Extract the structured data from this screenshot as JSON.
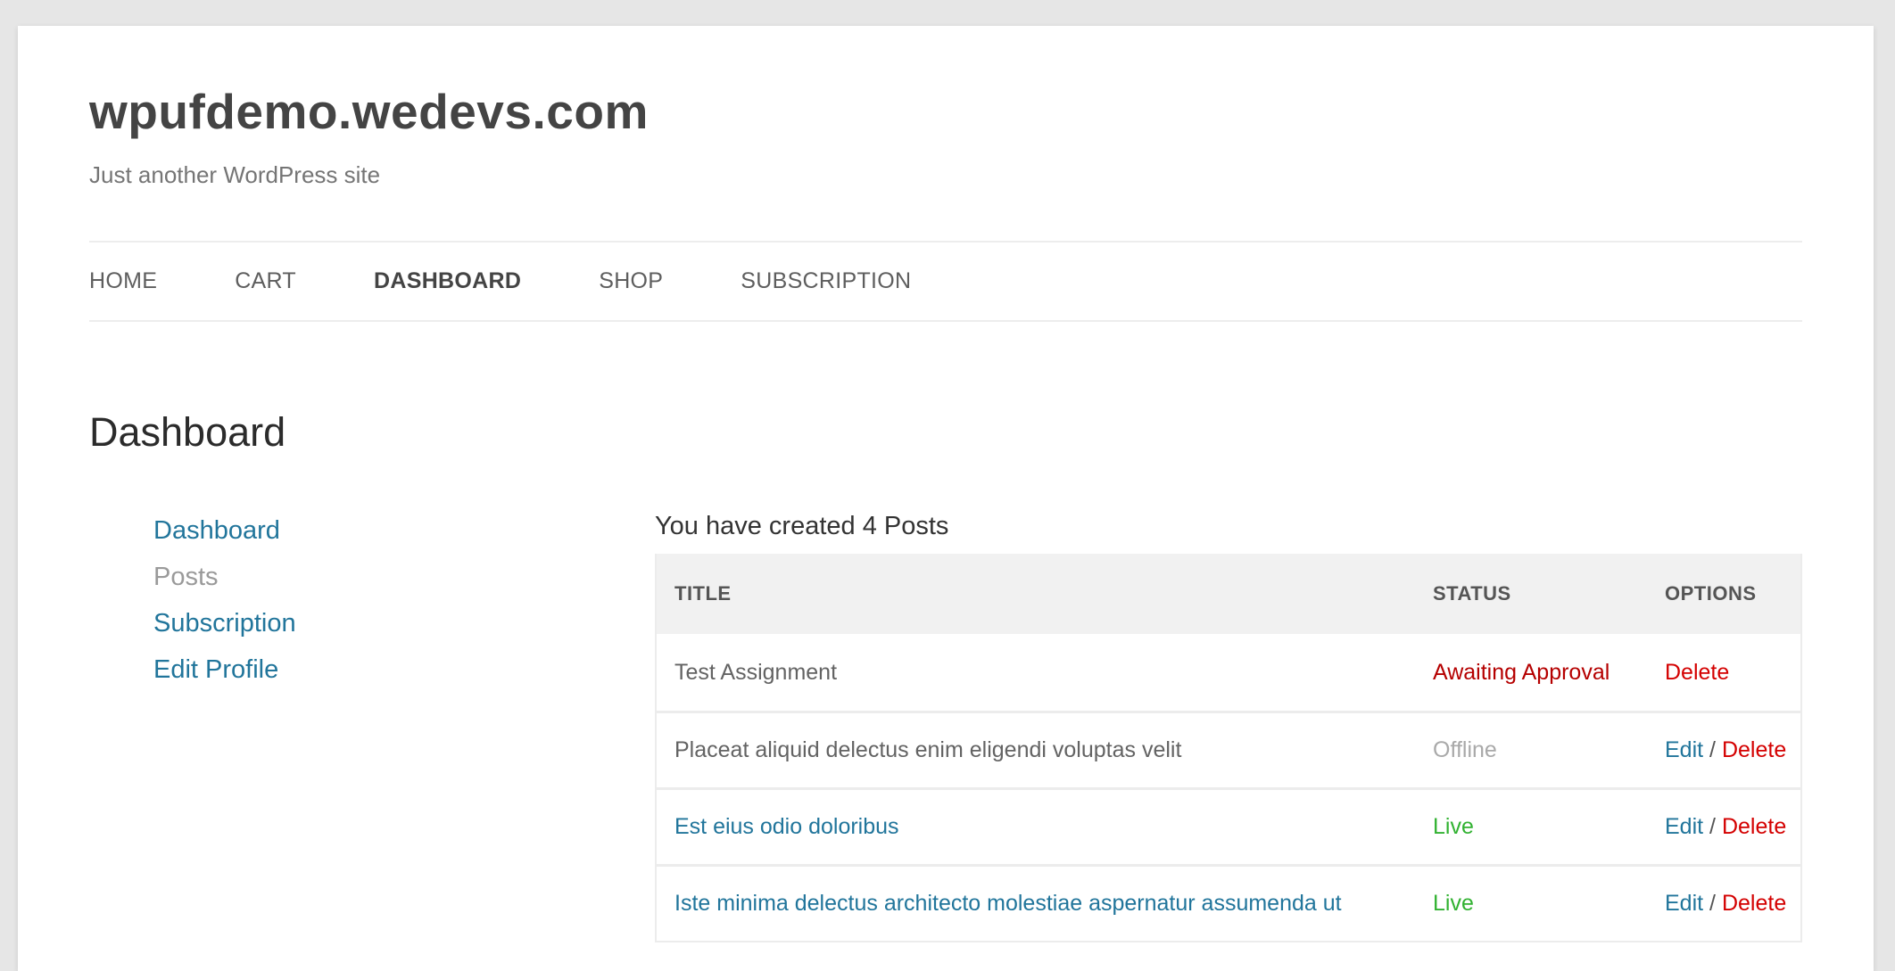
{
  "site": {
    "title": "wpufdemo.wedevs.com",
    "description": "Just another WordPress site"
  },
  "nav": {
    "items": [
      {
        "label": "HOME"
      },
      {
        "label": "CART"
      },
      {
        "label": "DASHBOARD",
        "active": true
      },
      {
        "label": "SHOP"
      },
      {
        "label": "SUBSCRIPTION"
      }
    ]
  },
  "page": {
    "title": "Dashboard"
  },
  "side_menu": {
    "items": [
      {
        "label": "Dashboard"
      },
      {
        "label": "Posts",
        "current": true
      },
      {
        "label": "Subscription"
      },
      {
        "label": "Edit Profile"
      }
    ]
  },
  "posts": {
    "summary": "You have created 4 Posts",
    "columns": {
      "title": "TITLE",
      "status": "STATUS",
      "options": "OPTIONS"
    },
    "separator": "/",
    "rows": [
      {
        "title": "Test Assignment",
        "status": "Awaiting Approval",
        "edit": "",
        "delete": "Delete"
      },
      {
        "title": "Placeat aliquid delectus enim eligendi voluptas velit",
        "status": "Offline",
        "edit": "Edit",
        "delete": "Delete"
      },
      {
        "title": "Est eius odio doloribus",
        "status": "Live",
        "edit": "Edit",
        "delete": "Delete"
      },
      {
        "title": "Iste minima delectus architecto molestiae aspernatur assumenda ut",
        "status": "Live",
        "edit": "Edit",
        "delete": "Delete"
      }
    ]
  },
  "colors": {
    "link": "#21759b",
    "delete": "#d40000",
    "awaiting": "#b50000",
    "offline": "#a9a9a9",
    "live": "#32b232"
  }
}
